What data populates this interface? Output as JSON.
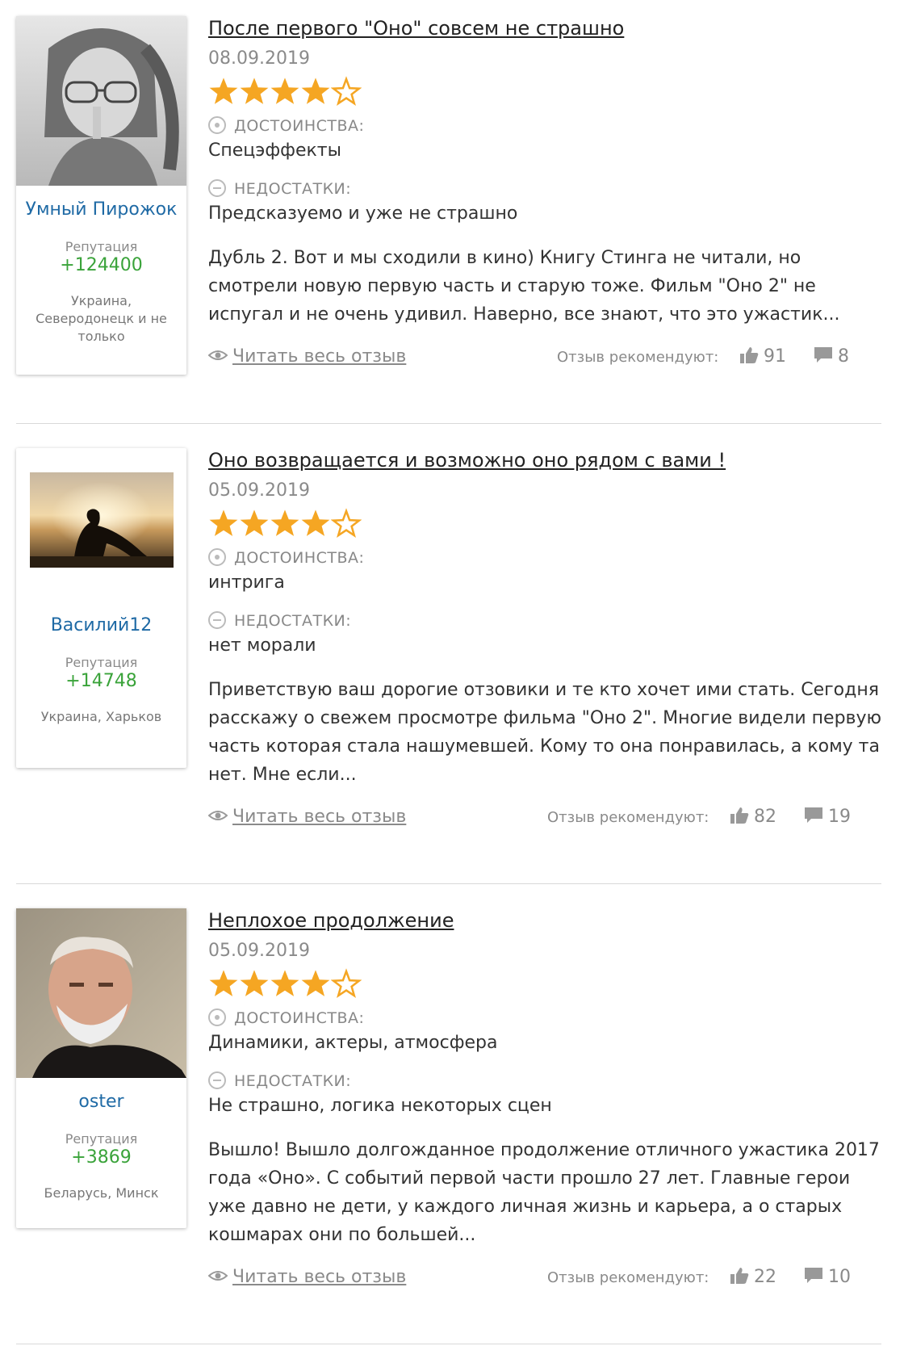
{
  "reviews": [
    {
      "title": "После первого \"Оно\" совсем не страшно",
      "date": "08.09.2019",
      "rating": 4,
      "rating_max": 5,
      "author": {
        "name": "Умный Пирожок",
        "reputation_label": "Репутация",
        "reputation": "+124400",
        "location": "Украина, Северодонецк и не только"
      },
      "pros_label": "ДОСТОИНСТВА:",
      "pros": "Спецэффекты",
      "cons_label": "НЕДОСТАТКИ:",
      "cons": "Предсказуемо и уже не страшно",
      "body": "Дубль 2. Вот и мы сходили в кино) Книгу Стинга не читали, но смотрели новую первую часть и старую тоже. Фильм \"Оно 2\" не испугал и не очень удивил. Наверно, все знают, что это ужастик...",
      "read_more": "Читать весь отзыв",
      "recommend_label": "Отзыв рекомендуют:",
      "likes": "91",
      "comments": "8"
    },
    {
      "title": "Оно возвращается и возможно оно рядом с вами !",
      "date": "05.09.2019",
      "rating": 4,
      "rating_max": 5,
      "author": {
        "name": "Василий12",
        "reputation_label": "Репутация",
        "reputation": "+14748",
        "location": "Украина, Харьков"
      },
      "pros_label": "ДОСТОИНСТВА:",
      "pros": "интрига",
      "cons_label": "НЕДОСТАТКИ:",
      "cons": "нет морали",
      "body": "Приветствую ваш дорогие отзовики и те кто хочет ими стать. Сегодня расскажу о свежем просмотре фильма \"Оно 2\". Многие видели первую часть которая стала нашумевшей. Кому то она понравилась, а кому та нет. Мне если...",
      "read_more": "Читать весь отзыв",
      "recommend_label": "Отзыв рекомендуют:",
      "likes": "82",
      "comments": "19"
    },
    {
      "title": "Неплохое продолжение",
      "date": "05.09.2019",
      "rating": 4,
      "rating_max": 5,
      "author": {
        "name": "oster",
        "reputation_label": "Репутация",
        "reputation": "+3869",
        "location": "Беларусь, Минск"
      },
      "pros_label": "ДОСТОИНСТВА:",
      "pros": "Динамики, актеры, атмосфера",
      "cons_label": "НЕДОСТАТКИ:",
      "cons": "Не страшно, логика некоторых сцен",
      "body": "Вышло! Вышло долгожданное продолжение отличного ужастика 2017 года «Оно». С событий первой части прошло 27 лет. Главные герои уже давно не дети, у каждого личная жизнь и карьера, а о старых кошмарах они по большей...",
      "read_more": "Читать весь отзыв",
      "recommend_label": "Отзыв рекомендуют:",
      "likes": "22",
      "comments": "10"
    }
  ],
  "colors": {
    "star": "#f5a623",
    "username": "#1f6aa5",
    "reputation": "#3aa33a",
    "muted": "#8a8a8a"
  },
  "icons": {
    "pros": "plus-circle-icon",
    "cons": "minus-circle-icon",
    "read": "eye-icon",
    "like": "thumbs-up-icon",
    "comment": "comment-icon"
  }
}
